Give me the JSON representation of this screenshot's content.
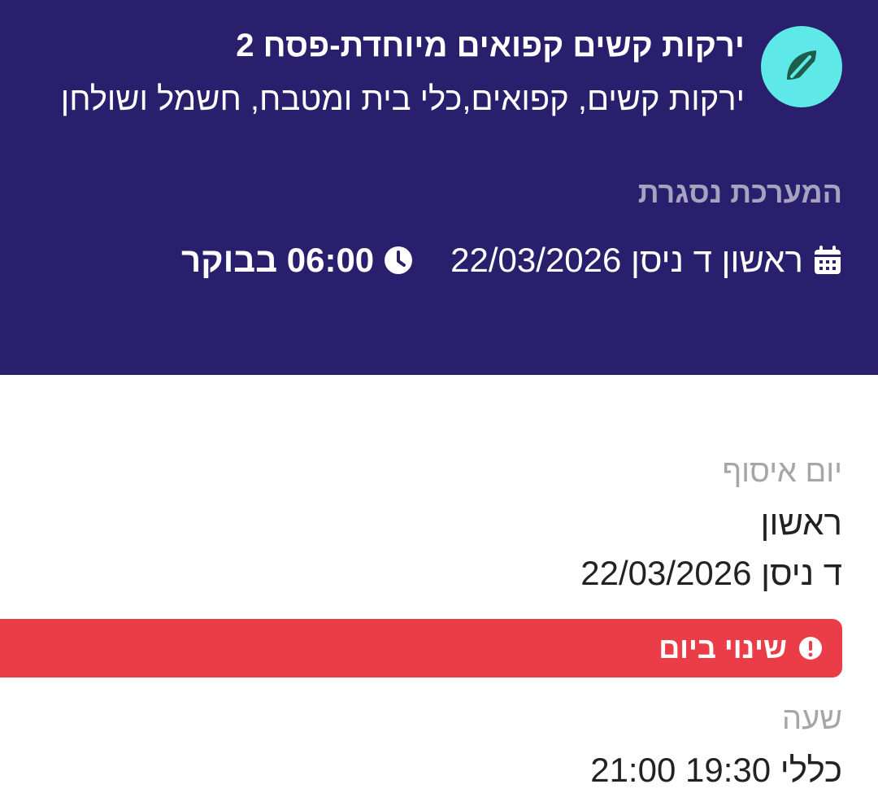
{
  "header": {
    "logo_icon": "leaf-icon",
    "title": "ירקות קשים קפואים מיוחדת-פסח 2",
    "subtitle": "ירקות קשים, קפואים,כלי בית ומטבח, חשמל ושולחן",
    "closed_notice": "המערכת נסגרת",
    "date": "ראשון ד ניסן 22/03/2026",
    "time": "06:00 בבוקר",
    "date_icon": "calendar-icon",
    "time_icon": "clock-icon"
  },
  "collection": {
    "day_label": "יום איסוף",
    "day_name": "ראשון",
    "day_date": "ד ניסן 22/03/2026",
    "change_alert": "שינוי ביום",
    "alert_icon": "exclamation-circle-icon",
    "hour_label": "שעה",
    "hour_value": "כללי 19:30 21:00"
  },
  "colors": {
    "header_bg": "#2a1f6d",
    "logo_bg": "#5ee8e8",
    "logo_fg": "#1c5e4c",
    "alert_bg": "#ea3d47"
  }
}
